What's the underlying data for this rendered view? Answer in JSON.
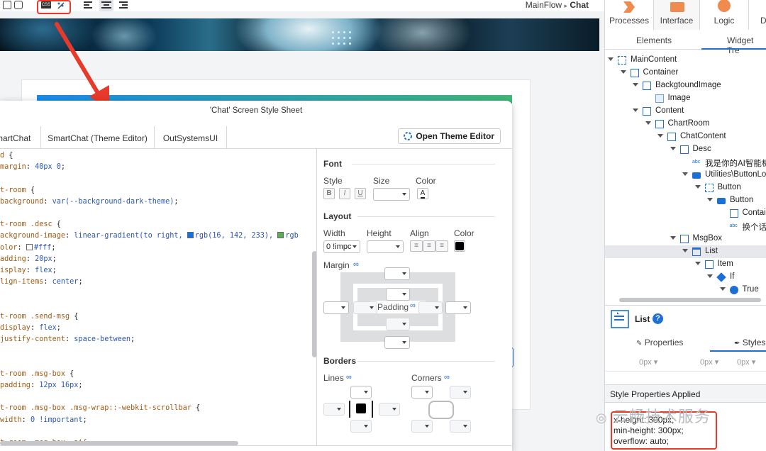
{
  "breadcrumb": {
    "flow": "MainFlow",
    "separator": "▸",
    "screen": "Chat"
  },
  "toolbar": {
    "css_icon_label": "CSS"
  },
  "right_panel": {
    "top_tabs": [
      "Processes",
      "Interface",
      "Logic",
      "D"
    ],
    "sub_tabs": [
      "Elements",
      "Widget Tre"
    ],
    "tree": [
      {
        "label": "MainContent",
        "depth": 0,
        "icon": "container-dashed-icon"
      },
      {
        "label": "Container",
        "depth": 1,
        "icon": "container-icon"
      },
      {
        "label": "BackgtoundImage",
        "depth": 2,
        "icon": "container-icon"
      },
      {
        "label": "Image",
        "depth": 3,
        "icon": "image-icon"
      },
      {
        "label": "Content",
        "depth": 2,
        "icon": "container-icon"
      },
      {
        "label": "ChartRoom",
        "depth": 3,
        "icon": "container-icon"
      },
      {
        "label": "ChatContent",
        "depth": 4,
        "icon": "container-icon"
      },
      {
        "label": "Desc",
        "depth": 5,
        "icon": "container-icon"
      },
      {
        "label": "我是你的AI智能机",
        "depth": 6,
        "icon": "text-icon"
      },
      {
        "label": "Utilities\\ButtonLo",
        "depth": 6,
        "icon": "block-icon"
      },
      {
        "label": "Button",
        "depth": 7,
        "icon": "container-dashed-icon"
      },
      {
        "label": "Button",
        "depth": 8,
        "icon": "button-icon"
      },
      {
        "label": "Contai",
        "depth": 9,
        "icon": "container-icon"
      },
      {
        "label": "换个话",
        "depth": 9,
        "icon": "text-icon"
      },
      {
        "label": "MsgBox",
        "depth": 5,
        "icon": "container-icon"
      },
      {
        "label": "List",
        "depth": 6,
        "icon": "list-icon",
        "selected": true
      },
      {
        "label": "Item",
        "depth": 7,
        "icon": "container-icon"
      },
      {
        "label": "If",
        "depth": 8,
        "icon": "if-icon"
      },
      {
        "label": "True",
        "depth": 9,
        "icon": "true-icon"
      }
    ],
    "selected_widget": "List",
    "prop_tabs": [
      "Properties",
      "Styles"
    ],
    "px_values": [
      "0px",
      "0px",
      "0px"
    ],
    "style_props_title": "Style Properties Applied",
    "style_props_lines": [
      "x-height: 300px;",
      "min-height: 300px;",
      "overflow: auto;"
    ],
    "watermark": "云畅技术服务"
  },
  "modal": {
    "title": "'Chat' Screen Style Sheet",
    "tabs": [
      "SmartChat",
      "SmartChat (Theme Editor)",
      "OutSystemsUI"
    ],
    "open_theme_label": "Open Theme Editor",
    "code_lines": [
      {
        "parts": [
          [
            "kw",
            "d "
          ],
          [
            "cm",
            "{"
          ]
        ]
      },
      {
        "parts": [
          [
            "kw",
            "margin"
          ],
          [
            "cm",
            ": "
          ],
          [
            "vl",
            "40px 0"
          ],
          [
            "cm",
            ";"
          ]
        ]
      },
      {
        "parts": []
      },
      {
        "parts": [
          [
            "kw",
            "t-room "
          ],
          [
            "cm",
            "{"
          ]
        ]
      },
      {
        "parts": [
          [
            "kw",
            "background"
          ],
          [
            "cm",
            ": "
          ],
          [
            "vl",
            "var(--background-dark-theme)"
          ],
          [
            "cm",
            ";"
          ]
        ]
      },
      {
        "parts": []
      },
      {
        "parts": [
          [
            "kw",
            "t-room .desc "
          ],
          [
            "cm",
            "{"
          ]
        ]
      },
      {
        "parts": [
          [
            "kw",
            "ackground-image"
          ],
          [
            "cm",
            ": "
          ],
          [
            "vl",
            "linear-gradient(to right, "
          ],
          [
            "sw",
            "#1072e9"
          ],
          [
            "vl",
            "rgb(16, 142, 233), "
          ],
          [
            "sw",
            "#55b24f"
          ],
          [
            "vl",
            "rgb"
          ]
        ]
      },
      {
        "parts": [
          [
            "kw",
            "olor"
          ],
          [
            "cm",
            ": "
          ],
          [
            "sw",
            "#ffffff"
          ],
          [
            "vl",
            "#fff"
          ],
          [
            "cm",
            ";"
          ]
        ]
      },
      {
        "parts": [
          [
            "kw",
            "adding"
          ],
          [
            "cm",
            ": "
          ],
          [
            "vl",
            "20px"
          ],
          [
            "cm",
            ";"
          ]
        ]
      },
      {
        "parts": [
          [
            "kw",
            "isplay"
          ],
          [
            "cm",
            ": "
          ],
          [
            "vl",
            "flex"
          ],
          [
            "cm",
            ";"
          ]
        ]
      },
      {
        "parts": [
          [
            "kw",
            "lign-items"
          ],
          [
            "cm",
            ": "
          ],
          [
            "vl",
            "center"
          ],
          [
            "cm",
            ";"
          ]
        ]
      },
      {
        "parts": []
      },
      {
        "parts": []
      },
      {
        "parts": [
          [
            "kw",
            "t-room .send-msg "
          ],
          [
            "cm",
            "{"
          ]
        ]
      },
      {
        "parts": [
          [
            "kw",
            "display"
          ],
          [
            "cm",
            ": "
          ],
          [
            "vl",
            "flex"
          ],
          [
            "cm",
            ";"
          ]
        ]
      },
      {
        "parts": [
          [
            "kw",
            "justify-content"
          ],
          [
            "cm",
            ": "
          ],
          [
            "vl",
            "space-between"
          ],
          [
            "cm",
            ";"
          ]
        ]
      },
      {
        "parts": []
      },
      {
        "parts": []
      },
      {
        "parts": [
          [
            "kw",
            "t-room .msg-box "
          ],
          [
            "cm",
            "{"
          ]
        ]
      },
      {
        "parts": [
          [
            "kw",
            "padding"
          ],
          [
            "cm",
            ": "
          ],
          [
            "vl",
            "12px 16px"
          ],
          [
            "cm",
            ";"
          ]
        ]
      },
      {
        "parts": []
      },
      {
        "parts": [
          [
            "kw",
            "t-room .msg-box .msg-wrap::-webkit-scrollbar "
          ],
          [
            "cm",
            "{"
          ]
        ]
      },
      {
        "parts": [
          [
            "kw",
            "width"
          ],
          [
            "cm",
            ": "
          ],
          [
            "vl",
            "0 !important"
          ],
          [
            "cm",
            ";"
          ]
        ]
      },
      {
        "parts": []
      },
      {
        "parts": [
          [
            "kw",
            "t-room .msg-box .ai{"
          ]
        ]
      }
    ],
    "style_editor": {
      "font_title": "Font",
      "font_labels": [
        "Style",
        "Size",
        "Color"
      ],
      "font_style_buttons": [
        "B",
        "I",
        "U"
      ],
      "layout_title": "Layout",
      "layout_labels": [
        "Width",
        "Height",
        "Align",
        "Color"
      ],
      "width_value": "0 !impc",
      "margin_label": "Margin",
      "padding_label": "Padding",
      "borders_title": "Borders",
      "lines_label": "Lines",
      "corners_label": "Corners",
      "layout_color": "#000000"
    }
  },
  "colors": {
    "accent_red": "#e83a2a",
    "link_blue": "#1d6fd6"
  }
}
